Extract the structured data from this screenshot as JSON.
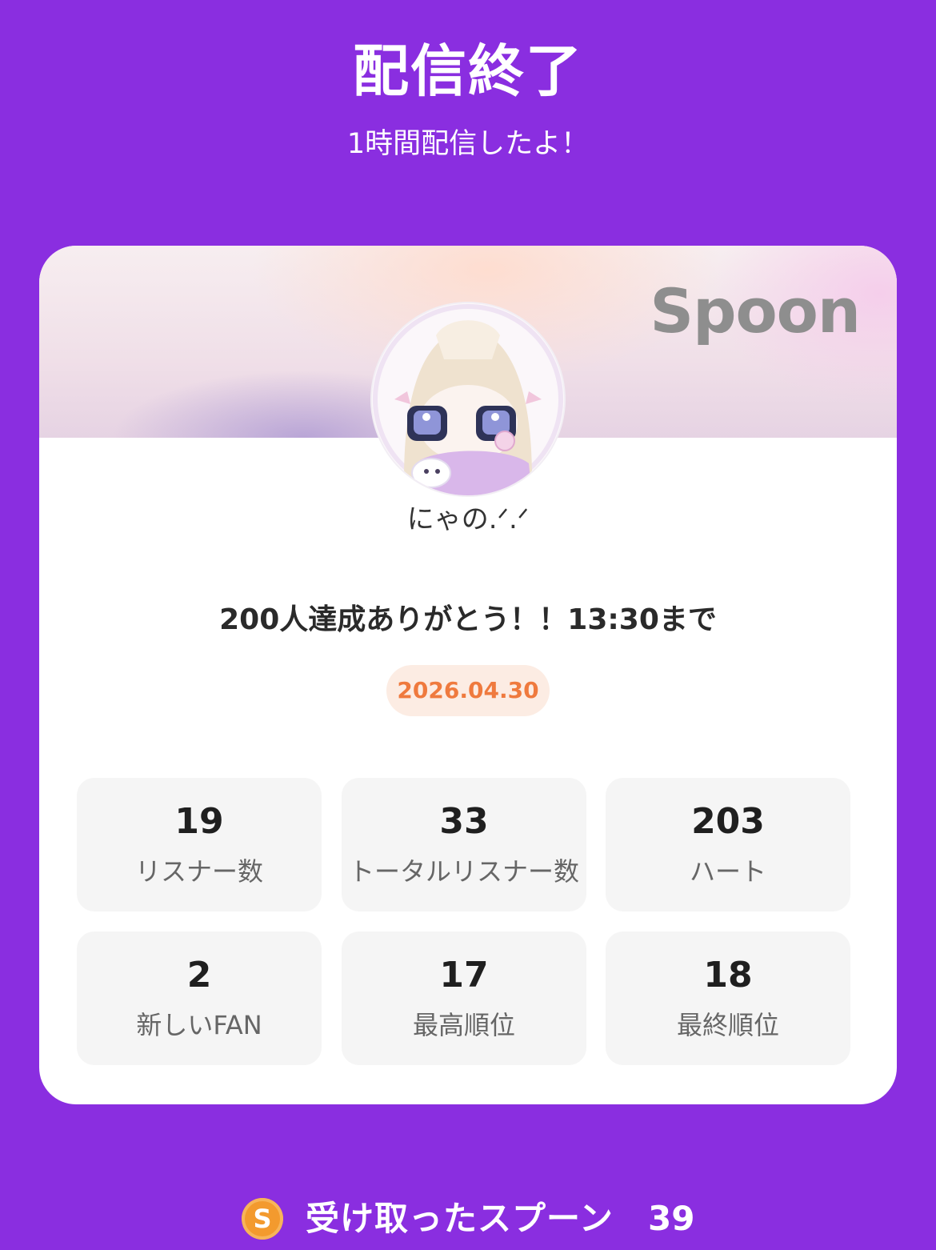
{
  "header": {
    "title": "配信終了",
    "subtitle": "1時間配信したよ！"
  },
  "card": {
    "brand": "Spoon",
    "avatar_icon": "user-avatar-image",
    "username": "にゃの.ᐟ.ᐟ",
    "live_title": "200人達成ありがとう！！13:30まで",
    "date": "2026.04.30",
    "stats": [
      {
        "value": "19",
        "label": "リスナー数"
      },
      {
        "value": "33",
        "label": "トータルリスナー数"
      },
      {
        "value": "203",
        "label": "ハート"
      },
      {
        "value": "2",
        "label": "新しいFAN"
      },
      {
        "value": "17",
        "label": "最高順位"
      },
      {
        "value": "18",
        "label": "最終順位"
      }
    ]
  },
  "footer": {
    "coin_icon": "spoon-coin-icon",
    "coin_letter": "S",
    "label": "受け取ったスプーン",
    "count": "39"
  },
  "colors": {
    "background": "#8a2ee0",
    "date_text": "#ef7a3e",
    "date_badge_bg": "#fcece3",
    "coin": "#f39a2e"
  }
}
